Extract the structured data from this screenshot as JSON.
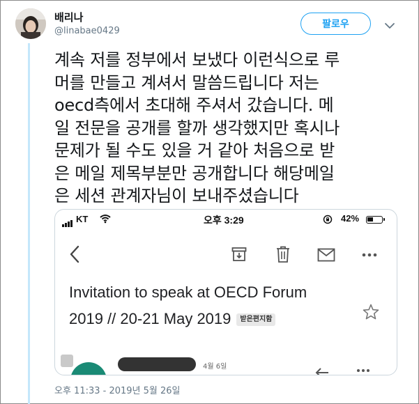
{
  "tweet": {
    "display_name": "배리나",
    "handle": "@linabae0429",
    "follow_label": "팔로우",
    "text": "계속 저를 정부에서 보냈다 이런식으로 루\n머를 만들고 계셔서 말씀드립니다 저는\noecd측에서 초대해 주셔서 갔습니다. 메\n일 전문을 공개를 할까 생각했지만 혹시나\n문제가 될 수도 있을 거 같아 처음으로 받\n은 메일 제목부분만 공개합니다 해당메일\n은 세션 관계자님이 보내주셨습니다",
    "timestamp": "오후 11:33 - 2019년 5월 26일"
  },
  "colors": {
    "accent": "#1da1f2",
    "thread_line": "#c4e7fb",
    "muted": "#657786"
  },
  "media": {
    "status_bar": {
      "carrier": "KT",
      "time": "오후 3:29",
      "battery": "42%",
      "battery_level": 0.42
    },
    "toolbar_icons": [
      "back-icon",
      "archive-icon",
      "trash-icon",
      "mail-icon",
      "more-icon"
    ],
    "subject_line1": "Invitation to speak at OECD Forum",
    "subject_line2": "2019 // 20-21 May 2019",
    "inbox_label": "받은편지함",
    "date": "4월 6일"
  }
}
